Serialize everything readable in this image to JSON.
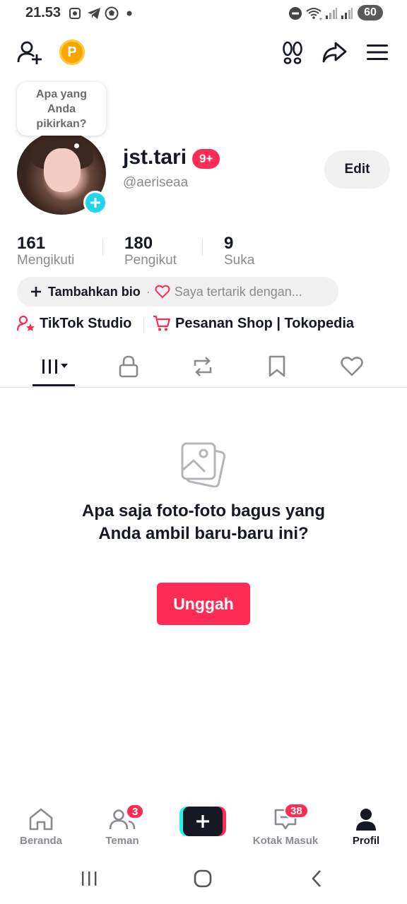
{
  "status_bar": {
    "time": "21.53",
    "battery": "60",
    "left_icons": [
      "screenshot-icon",
      "telegram-icon",
      "soccer-ball-icon",
      "dot-icon"
    ],
    "right_icons": [
      "do-not-disturb-icon",
      "wifi-icon",
      "signal-icon",
      "signal-icon"
    ]
  },
  "top_bar": {
    "coin_label": "P"
  },
  "bubble": {
    "line1": "Apa yang",
    "line2": "Anda",
    "line3": "pikirkan?"
  },
  "profile": {
    "username": "jst.tari",
    "badge": "9+",
    "handle": "@aeriseaa",
    "edit_label": "Edit"
  },
  "stats": [
    {
      "value": "161",
      "label": "Mengikuti"
    },
    {
      "value": "180",
      "label": "Pengikut"
    },
    {
      "value": "9",
      "label": "Suka"
    }
  ],
  "bio": {
    "add_label": "Tambahkan bio",
    "separator": "·",
    "interest_text": "Saya tertarik dengan..."
  },
  "links": {
    "studio": "TikTok Studio",
    "shop": "Pesanan Shop | Tokopedia"
  },
  "empty_state": {
    "message": "Apa saja foto-foto bagus yang Anda ambil baru-baru ini?",
    "button": "Unggah"
  },
  "bottom_nav": {
    "home": "Beranda",
    "friends": "Teman",
    "friends_badge": "3",
    "inbox": "Kotak Masuk",
    "inbox_badge": "38",
    "profile": "Profil"
  },
  "colors": {
    "accent": "#fe2c55",
    "cyan": "#25f4ee",
    "text": "#161823",
    "muted": "#8a8b91"
  }
}
